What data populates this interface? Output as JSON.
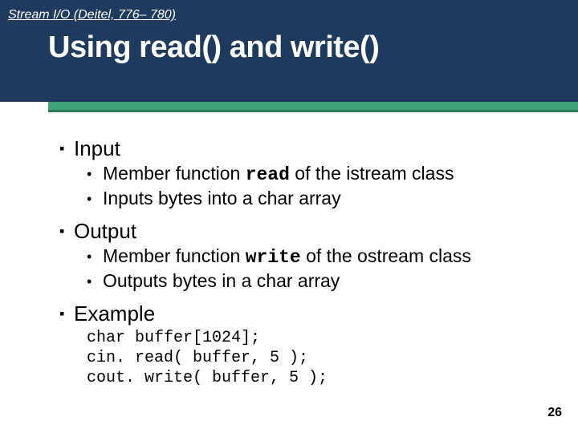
{
  "header": {
    "breadcrumb": "Stream I/O (Deitel, 776– 780)",
    "title": "Using read() and write()"
  },
  "sections": [
    {
      "heading": "Input",
      "items": [
        {
          "pre": "Member function ",
          "code": "read",
          "post": " of the istream class"
        },
        {
          "pre": "Inputs bytes into a char array",
          "code": "",
          "post": ""
        }
      ]
    },
    {
      "heading": "Output",
      "items": [
        {
          "pre": "Member function ",
          "code": "write",
          "post": " of the ostream class"
        },
        {
          "pre": "Outputs bytes in a char array",
          "code": "",
          "post": ""
        }
      ]
    }
  ],
  "example": {
    "heading": "Example",
    "code": [
      "char buffer[1024];",
      "cin. read( buffer, 5 );",
      "cout. write( buffer, 5 );"
    ]
  },
  "page_number": "26"
}
